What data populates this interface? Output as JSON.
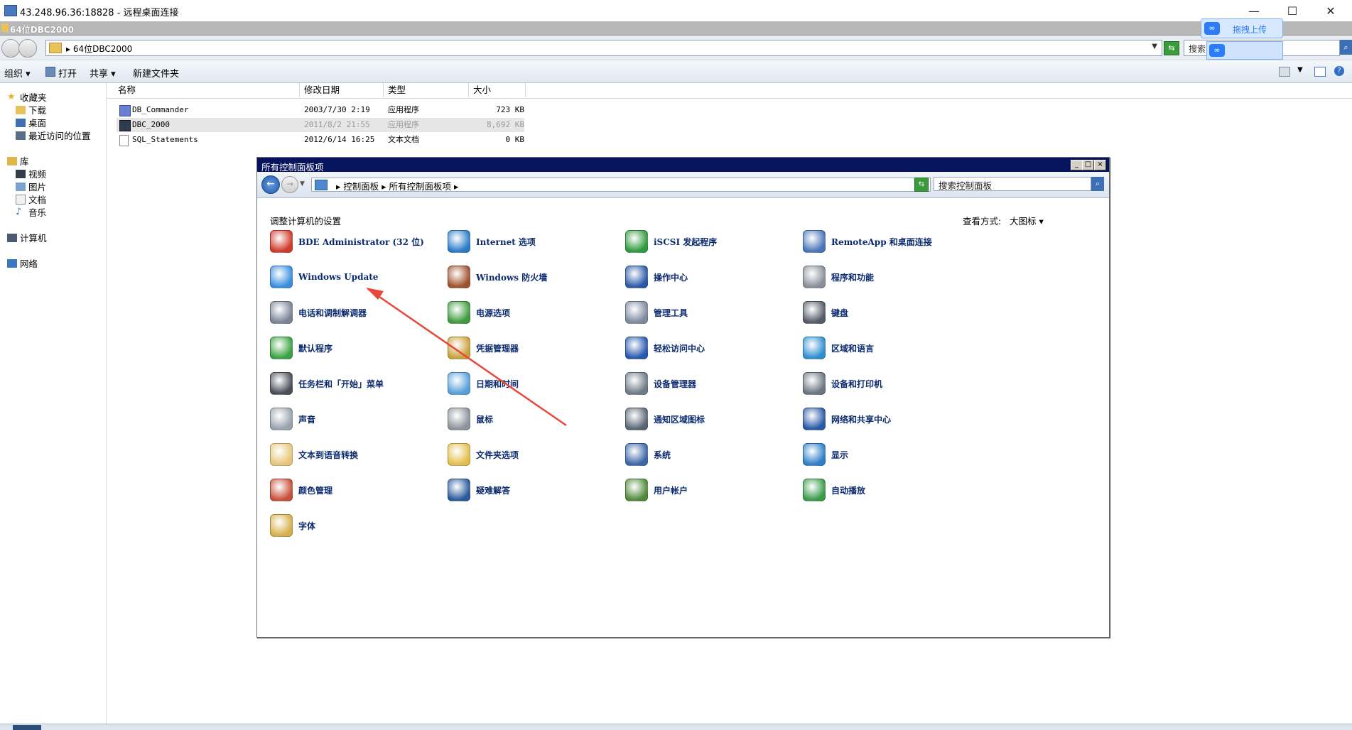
{
  "rdp": {
    "title": "43.248.96.36:18828 - 远程桌面连接",
    "minimize": "—",
    "maximize": "☐",
    "close": "✕"
  },
  "explorer": {
    "title": "64位DBC2000",
    "address": "▸ 64位DBC2000",
    "search_placeholder": "搜索",
    "toolbar": {
      "organize": "组织 ▾",
      "open": "打开",
      "share": "共享 ▾",
      "new_folder": "新建文件夹"
    },
    "nav": {
      "favorites": "收藏夹",
      "downloads": "下载",
      "desktop": "桌面",
      "recent": "最近访问的位置",
      "libraries": "库",
      "videos": "视频",
      "pictures": "图片",
      "documents": "文档",
      "music": "音乐",
      "computer": "计算机",
      "network": "网络"
    },
    "columns": [
      "名称",
      "修改日期",
      "类型",
      "大小"
    ],
    "files": [
      {
        "name": "DB_Commander",
        "date": "2003/7/30 2:19",
        "type": "应用程序",
        "size": "723 KB"
      },
      {
        "name": "DBC_2000",
        "date": "2011/8/2 21:55",
        "type": "应用程序",
        "size": "8,692 KB"
      },
      {
        "name": "SQL_Statements",
        "date": "2012/6/14 16:25",
        "type": "文本文档",
        "size": "0 KB"
      }
    ]
  },
  "baidu": {
    "upload_label": "拖拽上传"
  },
  "control_panel": {
    "title": "所有控制面板项",
    "breadcrumb": "▸ 控制面板 ▸ 所有控制面板项 ▸",
    "search_placeholder": "搜索控制面板",
    "heading": "调整计算机的设置",
    "view_label": "查看方式:",
    "view_value": "大图标 ▾",
    "items": [
      {
        "label": "BDE Administrator (32 位)",
        "icon": "bde-icon",
        "color": "#d03a2a"
      },
      {
        "label": "Internet 选项",
        "icon": "internet-options-icon",
        "color": "#2b7cc7"
      },
      {
        "label": "iSCSI 发起程序",
        "icon": "iscsi-icon",
        "color": "#2f9a3e"
      },
      {
        "label": "RemoteApp 和桌面连接",
        "icon": "remoteapp-icon",
        "color": "#4a76b8"
      },
      {
        "label": "Windows Update",
        "icon": "windows-update-icon",
        "color": "#3a8fe0"
      },
      {
        "label": "Windows 防火墙",
        "icon": "firewall-icon",
        "color": "#a0522d"
      },
      {
        "label": "操作中心",
        "icon": "action-center-icon",
        "color": "#2c5aa8"
      },
      {
        "label": "程序和功能",
        "icon": "programs-icon",
        "color": "#8a8f99"
      },
      {
        "label": "电话和调制解调器",
        "icon": "phone-modem-icon",
        "color": "#7b8596"
      },
      {
        "label": "电源选项",
        "icon": "power-icon",
        "color": "#3e9b3e"
      },
      {
        "label": "管理工具",
        "icon": "admin-tools-icon",
        "color": "#7d8aa0"
      },
      {
        "label": "键盘",
        "icon": "keyboard-icon",
        "color": "#555c66"
      },
      {
        "label": "默认程序",
        "icon": "default-programs-icon",
        "color": "#3ba343"
      },
      {
        "label": "凭据管理器",
        "icon": "credential-icon",
        "color": "#c9a23c"
      },
      {
        "label": "轻松访问中心",
        "icon": "ease-access-icon",
        "color": "#2858b0"
      },
      {
        "label": "区域和语言",
        "icon": "region-icon",
        "color": "#2f8fd0"
      },
      {
        "label": "任务栏和「开始」菜单",
        "icon": "taskbar-icon",
        "color": "#4a4f57"
      },
      {
        "label": "日期和时间",
        "icon": "datetime-icon",
        "color": "#5aa0d8"
      },
      {
        "label": "设备管理器",
        "icon": "device-manager-icon",
        "color": "#6f7a88"
      },
      {
        "label": "设备和打印机",
        "icon": "printers-icon",
        "color": "#6c7582"
      },
      {
        "label": "声音",
        "icon": "sound-icon",
        "color": "#9aa3ae"
      },
      {
        "label": "鼠标",
        "icon": "mouse-icon",
        "color": "#8c939c"
      },
      {
        "label": "通知区域图标",
        "icon": "notification-icon",
        "color": "#5b6675"
      },
      {
        "label": "网络和共享中心",
        "icon": "network-center-icon",
        "color": "#2b5aa8"
      },
      {
        "label": "文本到语音转换",
        "icon": "tts-icon",
        "color": "#e8c77a"
      },
      {
        "label": "文件夹选项",
        "icon": "folder-options-icon",
        "color": "#e3bf4e"
      },
      {
        "label": "系统",
        "icon": "system-icon",
        "color": "#3c66a8"
      },
      {
        "label": "显示",
        "icon": "display-icon",
        "color": "#2f7fc8"
      },
      {
        "label": "颜色管理",
        "icon": "color-management-icon",
        "color": "#c8503a"
      },
      {
        "label": "疑难解答",
        "icon": "troubleshoot-icon",
        "color": "#2a5a9a"
      },
      {
        "label": "用户帐户",
        "icon": "user-accounts-icon",
        "color": "#4f8a3a"
      },
      {
        "label": "自动播放",
        "icon": "autoplay-icon",
        "color": "#3a9b4a"
      },
      {
        "label": "字体",
        "icon": "fonts-icon",
        "color": "#d6b04a"
      }
    ]
  },
  "annotation": {
    "color": "#e8473a"
  }
}
